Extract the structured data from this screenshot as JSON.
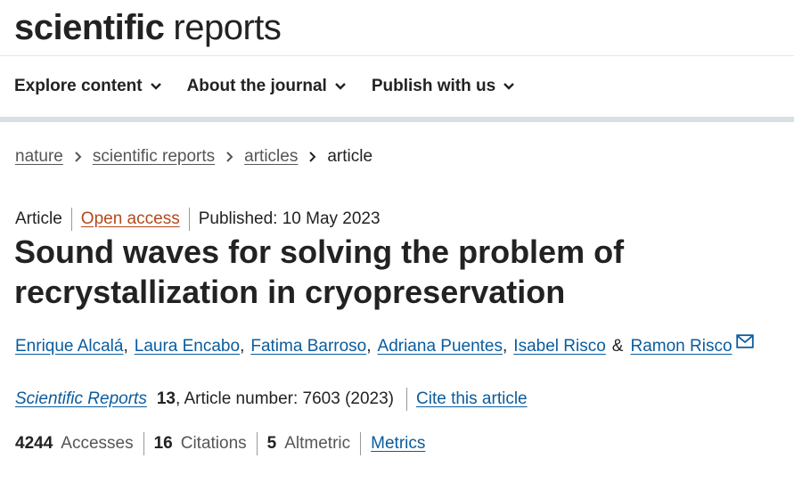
{
  "header": {
    "logo_bold": "scientific",
    "logo_light": "reports"
  },
  "nav": {
    "items": [
      {
        "label": "Explore content",
        "icon": "chevron-down-icon"
      },
      {
        "label": "About the journal",
        "icon": "chevron-down-icon"
      },
      {
        "label": "Publish with us",
        "icon": "chevron-down-icon"
      }
    ]
  },
  "breadcrumb": {
    "items": [
      "nature",
      "scientific reports",
      "articles"
    ],
    "current": "article",
    "separator_icon": "chevron-right-icon"
  },
  "article": {
    "type": "Article",
    "access": "Open access",
    "published": "Published: 10 May 2023",
    "title": "Sound waves for solving the problem of recrystallization in cryopreservation",
    "authors": [
      "Enrique Alcalá",
      "Laura Encabo",
      "Fatima Barroso",
      "Adriana Puentes",
      "Isabel Risco",
      "Ramon Risco"
    ],
    "author_separator": ",",
    "last_author_joiner": "&",
    "contact_icon": "mail-icon",
    "journal": "Scientific Reports",
    "volume": "13",
    "article_number_text": ", Article number: 7603 (2023)",
    "cite_label": "Cite this article"
  },
  "metrics": {
    "accesses_count": "4244",
    "accesses_label": "Accesses",
    "citations_count": "16",
    "citations_label": "Citations",
    "altmetric_count": "5",
    "altmetric_label": "Altmetric",
    "link_label": "Metrics"
  },
  "colors": {
    "link": "#0a5c9e",
    "open_access": "#b24a1b",
    "nav_bar": "#dadfe3",
    "text": "#222222"
  }
}
